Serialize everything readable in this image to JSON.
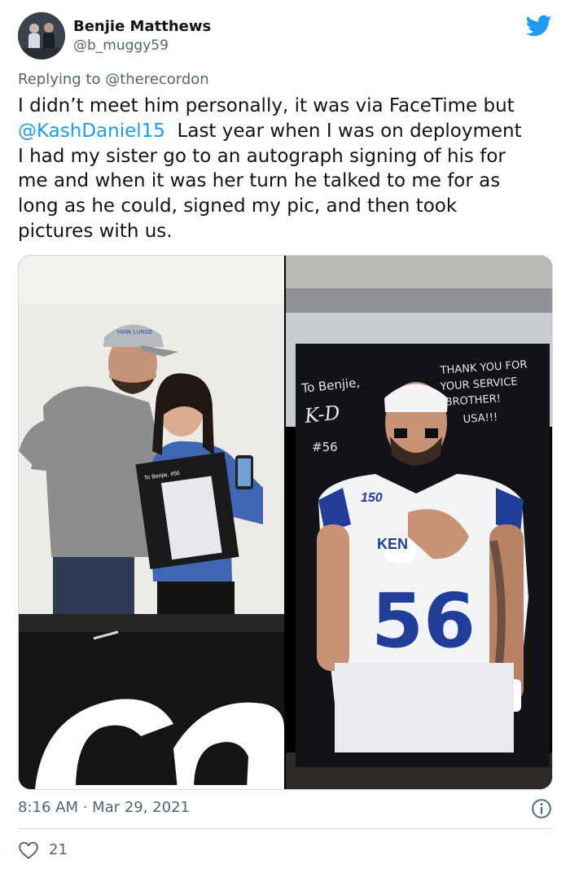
{
  "author": {
    "display_name": "Benjie Matthews",
    "handle": "@b_muggy59"
  },
  "reply": {
    "prefix": "Replying to",
    "mention": "@therecordon"
  },
  "body": {
    "line1": "I didn’t meet him personally, it was via FaceTime but",
    "line2_mention": "@KashDaniel15",
    "line2_rest": "  Last year when I was on deployment",
    "line3": "I had my sister go to an autograph signing of his for",
    "line4": "me and when it was her turn he talked to me for as",
    "line5": "long as he could, signed my pic, and then took",
    "line6": "pictures with us."
  },
  "media": {
    "left_photo": {
      "cap_text": "YANK LURGE",
      "poster_text": "To Benjie, #56"
    },
    "right_photo": {
      "dedication": "To Benjie,",
      "signature": "K-D",
      "number_tag": "#56",
      "message_1": "THANK YOU FOR",
      "message_2": "YOUR SERVICE",
      "message_3": "BROTHER!",
      "message_4": "USA!!!",
      "patch": "150",
      "jersey_text": "KEN",
      "jersey_number": "56"
    }
  },
  "footer": {
    "timestamp": "8:16 AM · Mar 29, 2021",
    "likes": "21"
  },
  "icons": {
    "brand": "twitter-bird-icon",
    "info": "info-icon",
    "like": "heart-icon"
  },
  "colors": {
    "link": "#1d9bf0",
    "secondary_text": "#536471",
    "uk_blue": "#1f3d99"
  }
}
